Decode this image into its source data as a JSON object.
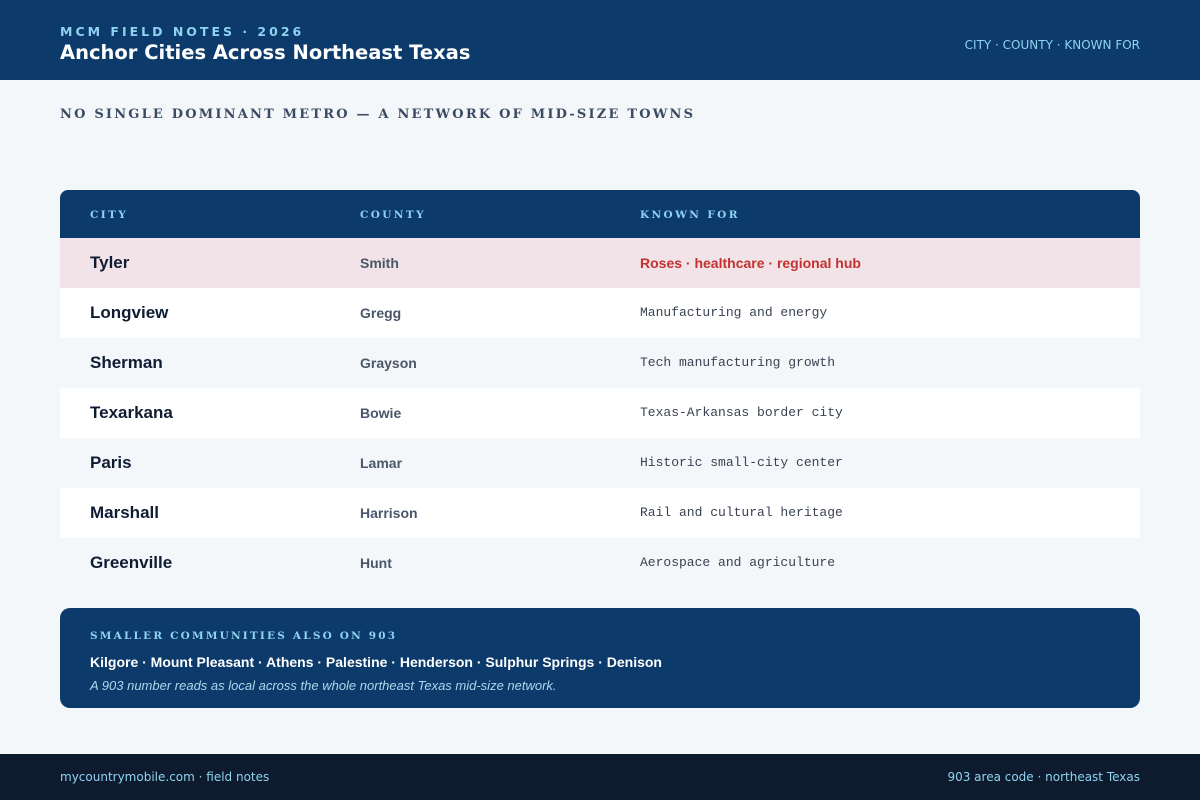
{
  "header": {
    "eyebrow": "MCM FIELD NOTES · 2026",
    "title": "Anchor Cities Across Northeast Texas",
    "tag": "CITY · COUNTY · KNOWN FOR"
  },
  "subhead": "NO SINGLE DOMINANT METRO — A NETWORK OF MID-SIZE TOWNS",
  "table": {
    "columns": [
      "CITY",
      "COUNTY",
      "KNOWN FOR"
    ],
    "rows": [
      {
        "city": "Tyler",
        "county": "Smith",
        "known_for": "Roses · healthcare · regional hub"
      },
      {
        "city": "Longview",
        "county": "Gregg",
        "known_for": "Manufacturing and energy"
      },
      {
        "city": "Sherman",
        "county": "Grayson",
        "known_for": "Tech manufacturing growth"
      },
      {
        "city": "Texarkana",
        "county": "Bowie",
        "known_for": "Texas-Arkansas border city"
      },
      {
        "city": "Paris",
        "county": "Lamar",
        "known_for": "Historic small-city center"
      },
      {
        "city": "Marshall",
        "county": "Harrison",
        "known_for": "Rail and cultural heritage"
      },
      {
        "city": "Greenville",
        "county": "Hunt",
        "known_for": "Aerospace and agriculture"
      }
    ]
  },
  "callout": {
    "label": "SMALLER COMMUNITIES ALSO ON 903",
    "list": "Kilgore · Mount Pleasant · Athens · Palestine · Henderson · Sulphur Springs · Denison",
    "note": "A 903 number reads as local across the whole northeast Texas mid-size network."
  },
  "footer": {
    "left": "mycountrymobile.com · field notes",
    "right": "903 area code · northeast Texas"
  },
  "colors": {
    "navy": "#0b3a6b",
    "accent_cyan": "#8fd3f0",
    "highlight_row": "#f1e3e7",
    "highlight_text": "#c53030",
    "footer_bg": "#0e1a2e"
  }
}
